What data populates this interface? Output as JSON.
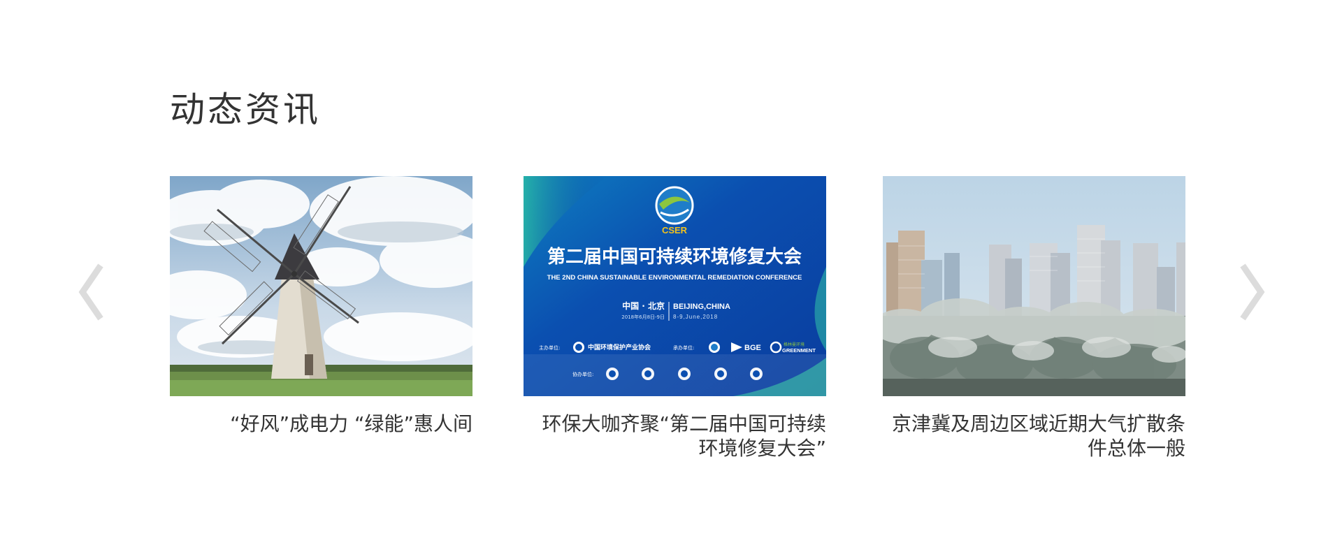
{
  "section": {
    "title": "动态资讯"
  },
  "nav": {
    "prev_icon": "chevron-left-icon",
    "next_icon": "chevron-right-icon",
    "arrow_color": "#d8d8d8"
  },
  "news": [
    {
      "caption": "“好风”成电力 “绿能”惠人间",
      "image": "windmill-photo"
    },
    {
      "caption": "环保大咖齐聚“第二届中国可持续环境修复大会”",
      "image": "conference-banner",
      "banner": {
        "logo_text": "CSER",
        "title_cn": "第二届中国可持续环境修复大会",
        "title_en": "THE 2ND CHINA SUSTAINABLE  ENVIRONMENTAL REMEDIATION CONFERENCE",
        "location_cn": "中国 · 北京",
        "date_cn": "2018年6月8日-9日",
        "location_en": "BEIJING,CHINA",
        "date_en": "8-9,June,2018",
        "host_label": "主办单位:",
        "host_name": "中国环境保护产业协会",
        "organizer_label": "承办单位:",
        "organizer_bge": "BGE",
        "organizer_green": "GREENMENT",
        "organizer_green_cn": "格林曼环境",
        "co_label": "协办单位:"
      }
    },
    {
      "caption": "京津冀及周边区域近期大气扩散条件总体一般",
      "image": "city-frost-photo"
    }
  ]
}
